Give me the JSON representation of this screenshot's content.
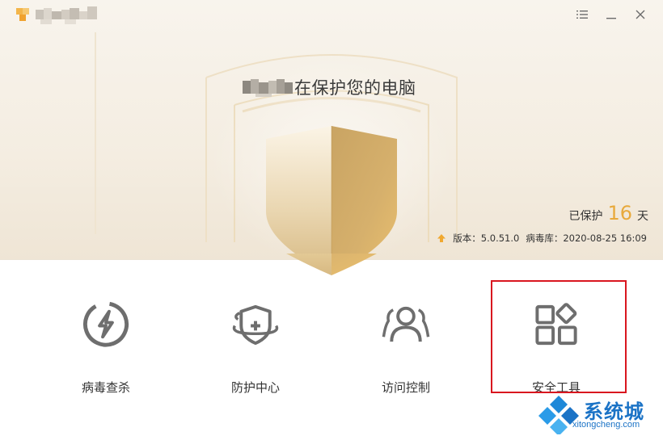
{
  "hero": {
    "headline": "在保护您的电脑",
    "protected_prefix": "已保护",
    "protected_days": "16",
    "protected_suffix": "天",
    "version": "版本：5.0.51.0",
    "virus_db": "病毒库：2020-08-25 16:09"
  },
  "features": [
    {
      "label": "病毒查杀",
      "icon": "bolt-icon"
    },
    {
      "label": "防护中心",
      "icon": "shield-plus-icon"
    },
    {
      "label": "访问控制",
      "icon": "users-icon"
    },
    {
      "label": "安全工具",
      "icon": "apps-grid-icon"
    }
  ],
  "watermark": {
    "title": "系统城",
    "url": "xitongcheng.com"
  },
  "colors": {
    "accent_orange": "#e8a93b",
    "shield_gold": "#c9a463",
    "highlight_red": "#d9161f",
    "watermark_blue": "#1b73c6",
    "icon_gray": "#6e6e6e"
  }
}
